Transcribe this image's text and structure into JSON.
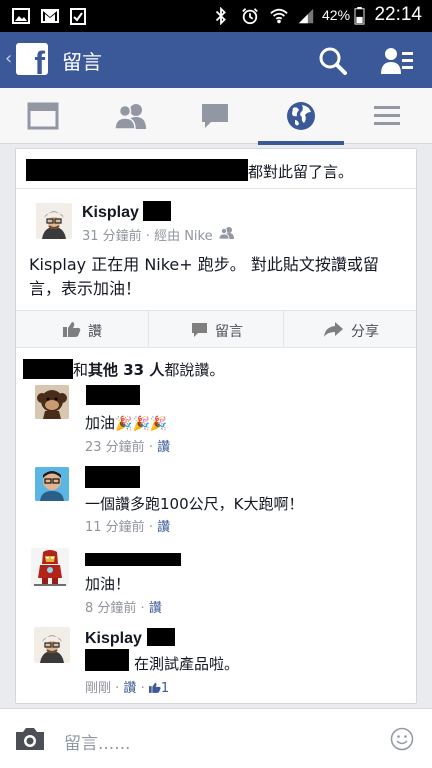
{
  "status_bar": {
    "battery": "42%",
    "time": "22:14",
    "icons": [
      "image-icon",
      "gmail-icon",
      "clipboard-icon",
      "bluetooth-icon",
      "alarm-icon",
      "wifi-icon",
      "signal-icon",
      "battery-icon"
    ]
  },
  "header": {
    "title": "留言",
    "back_glyph": "‹",
    "logo_glyph": "f"
  },
  "tabs": [
    {
      "name": "news-feed",
      "icon": "news-feed-icon",
      "active": false
    },
    {
      "name": "friends",
      "icon": "friends-icon",
      "active": false
    },
    {
      "name": "messages",
      "icon": "messages-icon",
      "active": false
    },
    {
      "name": "notifications",
      "icon": "globe-icon",
      "active": true
    },
    {
      "name": "more",
      "icon": "menu-icon",
      "active": false
    }
  ],
  "post": {
    "notice_suffix": "都對此留了言。",
    "author": "Kisplay",
    "meta": "31 分鐘前 · 經由 Nike",
    "text_line1": "Kisplay 正在用 Nike+ 跑步。 對此貼文按讚或留",
    "text_line2": "言，表示加油！",
    "actions": {
      "like": "讚",
      "comment": "留言",
      "share": "分享"
    },
    "likes_mid": "和",
    "likes_bold": "其他 33 人",
    "likes_end": "都說讚。"
  },
  "comments": [
    {
      "text": "加油",
      "emoji": "🎉🎉🎉",
      "time": "23 分鐘前",
      "like": "讚"
    },
    {
      "text": "一個讚多跑100公尺，K大跑啊！",
      "time": "11 分鐘前",
      "like": "讚"
    },
    {
      "text": "加油！",
      "time": "8 分鐘前",
      "like": "讚"
    },
    {
      "author": "Kisplay",
      "text": "在測試產品啦。",
      "time": "剛剛",
      "like": "讚",
      "like_count": "1"
    }
  ],
  "bottom": {
    "placeholder": "留言......"
  },
  "colors": {
    "brand": "#3b5998",
    "link": "#3b5998",
    "meta": "#90949c"
  }
}
